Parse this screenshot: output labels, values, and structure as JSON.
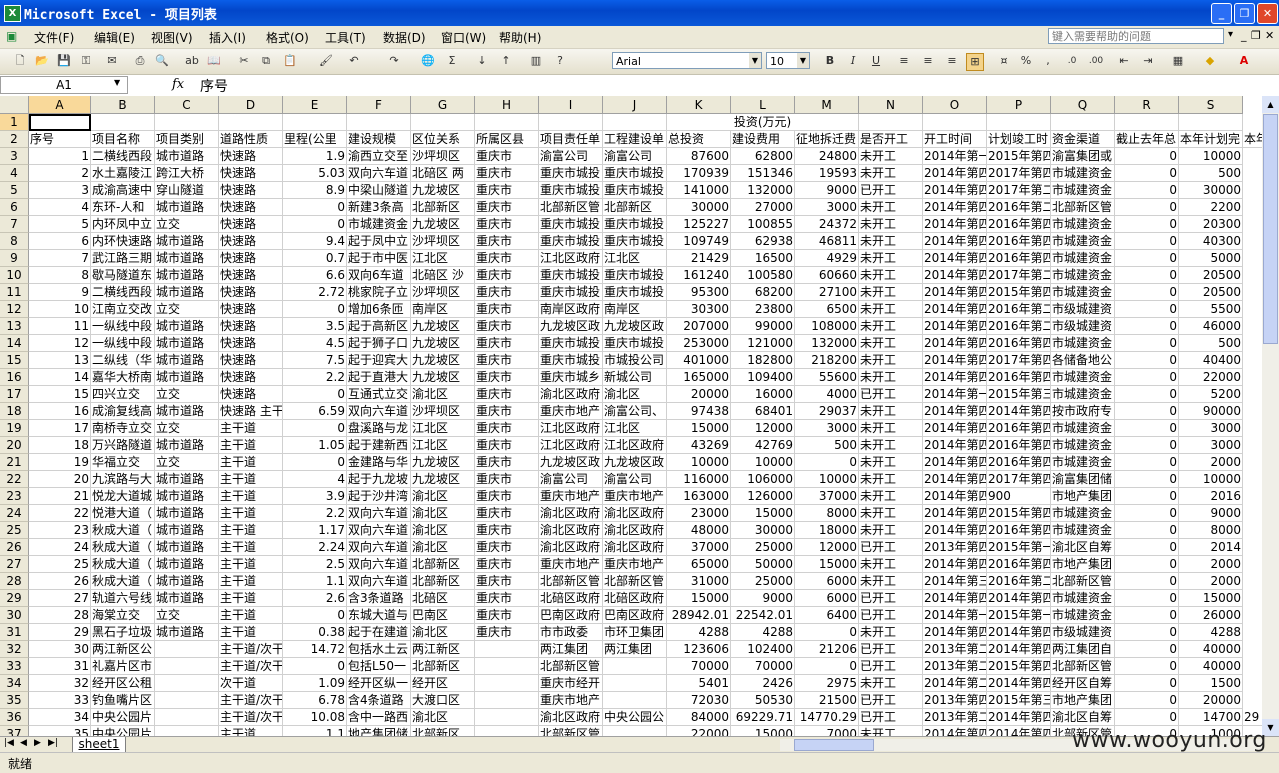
{
  "window": {
    "title": "Microsoft Excel - 项目列表",
    "app_icon": "X"
  },
  "menu": {
    "items": [
      "文件(F)",
      "编辑(E)",
      "视图(V)",
      "插入(I)",
      "格式(O)",
      "工具(T)",
      "数据(D)",
      "窗口(W)",
      "帮助(H)"
    ],
    "help_placeholder": "键入需要帮助的问题"
  },
  "toolbar": {
    "font": "Arial",
    "size": "10",
    "zoom_icons": [
      "bold",
      "italic",
      "underline"
    ]
  },
  "formula": {
    "cell": "A1",
    "fx": "fx",
    "value": "序号"
  },
  "columns": [
    "A",
    "B",
    "C",
    "D",
    "E",
    "F",
    "G",
    "H",
    "I",
    "J",
    "K",
    "L",
    "M",
    "N",
    "O",
    "P",
    "Q",
    "R",
    "S"
  ],
  "rows_numbers": [
    "1",
    "2",
    "3",
    "4",
    "5",
    "6",
    "7",
    "8",
    "9",
    "10",
    "11",
    "12",
    "13",
    "14",
    "15",
    "16",
    "17",
    "18",
    "19",
    "20",
    "21",
    "22",
    "23",
    "24",
    "25",
    "26",
    "27",
    "28",
    "29",
    "30",
    "31",
    "32",
    "33",
    "34",
    "35",
    "36",
    "37"
  ],
  "row1_merged": "投资(万元)",
  "headers": [
    "序号",
    "项目名称",
    "项目类别",
    "道路性质",
    "里程(公里",
    "建设规模",
    "区位关系",
    "所属区县",
    "项目责任单",
    "工程建设单",
    "总投资",
    "建设费用",
    "征地拆迁费",
    "是否开工",
    "开工时间",
    "计划竣工时",
    "资金渠道",
    "截止去年总",
    "本年计划完",
    "本年"
  ],
  "rows": [
    [
      "1",
      "二横线西段",
      "城市道路",
      "快速路",
      "1.9",
      "渝西立交至",
      "沙坪坝区",
      "重庆市",
      "渝富公司",
      "渝富公司",
      "87600",
      "62800",
      "24800",
      "未开工",
      "2014年第一",
      "2015年第四",
      "渝富集团或",
      "0",
      "10000"
    ],
    [
      "2",
      "水土嘉陵江",
      "跨江大桥",
      "快速路",
      "5.03",
      "双向六车道",
      "北碚区 两",
      "重庆市",
      "重庆市城投",
      "重庆市城投",
      "170939",
      "151346",
      "19593",
      "未开工",
      "2014年第四",
      "2017年第四",
      "市城建资金",
      "0",
      "500"
    ],
    [
      "3",
      "成渝高速中",
      "穿山隧道",
      "快速路",
      "8.9",
      "中梁山隧道",
      "九龙坡区",
      "重庆市",
      "重庆市城投",
      "重庆市城投",
      "141000",
      "132000",
      "9000",
      "已开工",
      "2014年第四",
      "2017年第二",
      "市城建资金",
      "0",
      "30000"
    ],
    [
      "4",
      "东环-人和",
      "城市道路",
      "快速路",
      "0",
      "新建3条高",
      "北部新区",
      "重庆市",
      "北部新区管",
      "北部新区",
      "30000",
      "27000",
      "3000",
      "未开工",
      "2014年第四",
      "2016年第二",
      "北部新区管",
      "0",
      "2200"
    ],
    [
      "5",
      "内环凤中立",
      "立交",
      "快速路",
      "0",
      "市城建资金",
      "九龙坡区",
      "重庆市",
      "重庆市城投",
      "重庆市城投",
      "125227",
      "100855",
      "24372",
      "未开工",
      "2014年第四",
      "2016年第四",
      "市城建资金",
      "0",
      "20300"
    ],
    [
      "6",
      "内环快速路",
      "城市道路",
      "快速路",
      "9.4",
      "起于凤中立",
      "沙坪坝区",
      "重庆市",
      "重庆市城投",
      "重庆市城投",
      "109749",
      "62938",
      "46811",
      "未开工",
      "2014年第四",
      "2016年第四",
      "市城建资金",
      "0",
      "40300"
    ],
    [
      "7",
      "武江路三期",
      "城市道路",
      "快速路",
      "0.7",
      "起于市中医",
      "江北区",
      "重庆市",
      "江北区政府",
      "江北区",
      "21429",
      "16500",
      "4929",
      "未开工",
      "2014年第四",
      "2016年第四",
      "市城建资金",
      "0",
      "5000"
    ],
    [
      "8",
      "歇马隧道东",
      "城市道路",
      "快速路",
      "6.6",
      "双向6车道",
      "北碚区 沙",
      "重庆市",
      "重庆市城投",
      "重庆市城投",
      "161240",
      "100580",
      "60660",
      "未开工",
      "2014年第四",
      "2017年第二",
      "市城建资金",
      "0",
      "20500"
    ],
    [
      "9",
      "二横线西段",
      "城市道路",
      "快速路",
      "2.72",
      "桃家院子立",
      "沙坪坝区",
      "重庆市",
      "重庆市城投",
      "重庆市城投",
      "95300",
      "68200",
      "27100",
      "未开工",
      "2014年第四",
      "2015年第四",
      "市城建资金",
      "0",
      "20500"
    ],
    [
      "10",
      "江南立交改",
      "立交",
      "快速路",
      "0",
      "增加6条匝",
      "南岸区",
      "重庆市",
      "南岸区政府",
      "南岸区",
      "30300",
      "23800",
      "6500",
      "未开工",
      "2014年第四",
      "2016年第二",
      "市级城建资",
      "0",
      "5500"
    ],
    [
      "11",
      "一纵线中段",
      "城市道路",
      "快速路",
      "3.5",
      "起于高新区",
      "九龙坡区",
      "重庆市",
      "九龙坡区政",
      "九龙坡区政",
      "207000",
      "99000",
      "108000",
      "未开工",
      "2014年第四",
      "2016年第二",
      "市级城建资",
      "0",
      "46000"
    ],
    [
      "12",
      "一纵线中段",
      "城市道路",
      "快速路",
      "4.5",
      "起于狮子口",
      "九龙坡区",
      "重庆市",
      "重庆市城投",
      "重庆市城投",
      "253000",
      "121000",
      "132000",
      "未开工",
      "2014年第四",
      "2016年第四",
      "市城建资金",
      "0",
      "500"
    ],
    [
      "13",
      "二纵线（华",
      "城市道路",
      "快速路",
      "7.5",
      "起于迎宾大",
      "九龙坡区",
      "重庆市",
      "重庆市城投",
      "市城投公司",
      "401000",
      "182800",
      "218200",
      "未开工",
      "2014年第四",
      "2017年第四",
      "各储备地公",
      "0",
      "40400"
    ],
    [
      "14",
      "嘉华大桥南",
      "城市道路",
      "快速路",
      "2.2",
      "起于直港大",
      "九龙坡区",
      "重庆市",
      "重庆市城乡",
      "新城公司",
      "165000",
      "109400",
      "55600",
      "未开工",
      "2014年第四",
      "2016年第四",
      "市城建资金",
      "0",
      "22000"
    ],
    [
      "15",
      "四兴立交",
      "立交",
      "快速路",
      "0",
      "互通式立交",
      "渝北区",
      "重庆市",
      "渝北区政府",
      "渝北区",
      "20000",
      "16000",
      "4000",
      "已开工",
      "2014年第一",
      "2015年第三",
      "市城建资金",
      "0",
      "5200"
    ],
    [
      "16",
      "成渝复线高",
      "城市道路",
      "快速路 主干",
      "6.59",
      "双向六车道",
      "沙坪坝区",
      "重庆市",
      "重庆市地产",
      "渝富公司、",
      "97438",
      "68401",
      "29037",
      "未开工",
      "2014年第四",
      "2014年第四",
      "按市政府专",
      "0",
      "90000"
    ],
    [
      "17",
      "南桥寺立交",
      "立交",
      "主干道",
      "0",
      "盘溪路与龙",
      "江北区",
      "重庆市",
      "江北区政府",
      "江北区",
      "15000",
      "12000",
      "3000",
      "未开工",
      "2014年第四",
      "2016年第四",
      "市城建资金",
      "0",
      "3000"
    ],
    [
      "18",
      "万兴路隧道",
      "城市道路",
      "主干道",
      "1.05",
      "起于建新西",
      "江北区",
      "重庆市",
      "江北区政府",
      "江北区政府",
      "43269",
      "42769",
      "500",
      "未开工",
      "2014年第四",
      "2016年第四",
      "市城建资金",
      "0",
      "3000"
    ],
    [
      "19",
      "华福立交",
      "立交",
      "主干道",
      "0",
      "金建路与华",
      "九龙坡区",
      "重庆市",
      "九龙坡区政",
      "九龙坡区政",
      "10000",
      "10000",
      "0",
      "未开工",
      "2014年第四",
      "2016年第四",
      "市城建资金",
      "0",
      "2000"
    ],
    [
      "20",
      "九滨路与大",
      "城市道路",
      "主干道",
      "4",
      "起于九龙坡",
      "九龙坡区",
      "重庆市",
      "渝富公司",
      "渝富公司",
      "116000",
      "106000",
      "10000",
      "未开工",
      "2014年第四",
      "2017年第四",
      "渝富集团储",
      "0",
      "10000"
    ],
    [
      "21",
      "悦龙大道城",
      "城市道路",
      "主干道",
      "3.9",
      "起于沙井湾",
      "渝北区",
      "重庆市",
      "重庆市地产",
      "重庆市地产",
      "163000",
      "126000",
      "37000",
      "未开工",
      "2014年第四",
      "900",
      "市地产集团",
      "0",
      "2016"
    ],
    [
      "22",
      "悦港大道（",
      "城市道路",
      "主干道",
      "2.2",
      "双向六车道",
      "渝北区",
      "重庆市",
      "渝北区政府",
      "渝北区政府",
      "23000",
      "15000",
      "8000",
      "未开工",
      "2014年第四",
      "2015年第四",
      "市城建资金",
      "0",
      "9000"
    ],
    [
      "23",
      "秋成大道（",
      "城市道路",
      "主干道",
      "1.17",
      "双向六车道",
      "渝北区",
      "重庆市",
      "渝北区政府",
      "渝北区政府",
      "48000",
      "30000",
      "18000",
      "未开工",
      "2014年第四",
      "2016年第四",
      "市城建资金",
      "0",
      "8000"
    ],
    [
      "24",
      "秋成大道（",
      "城市道路",
      "主干道",
      "2.24",
      "双向六车道",
      "渝北区",
      "重庆市",
      "渝北区政府",
      "渝北区政府",
      "37000",
      "25000",
      "12000",
      "已开工",
      "2013年第四",
      "2015年第一",
      "渝北区自筹",
      "0",
      "2014"
    ],
    [
      "25",
      "秋成大道（",
      "城市道路",
      "主干道",
      "2.5",
      "双向六车道",
      "北部新区",
      "重庆市",
      "重庆市地产",
      "重庆市地产",
      "65000",
      "50000",
      "15000",
      "未开工",
      "2014年第四",
      "2016年第四",
      "市地产集团",
      "0",
      "2000"
    ],
    [
      "26",
      "秋成大道（",
      "城市道路",
      "主干道",
      "1.1",
      "双向六车道",
      "北部新区",
      "重庆市",
      "北部新区管",
      "北部新区管",
      "31000",
      "25000",
      "6000",
      "未开工",
      "2014年第三",
      "2016年第二",
      "北部新区管",
      "0",
      "2000"
    ],
    [
      "27",
      "轨道六号线",
      "城市道路",
      "主干道",
      "2.6",
      "含3条道路",
      "北碚区",
      "重庆市",
      "北碚区政府",
      "北碚区政府",
      "15000",
      "9000",
      "6000",
      "已开工",
      "2014年第四",
      "2014年第四",
      "市城建资金",
      "0",
      "15000"
    ],
    [
      "28",
      "海棠立交",
      "立交",
      "主干道",
      "0",
      "东城大道与",
      "巴南区",
      "重庆市",
      "巴南区政府",
      "巴南区政府",
      "28942.01",
      "22542.01",
      "6400",
      "已开工",
      "2014年第一",
      "2015年第一",
      "市城建资金",
      "0",
      "26000"
    ],
    [
      "29",
      "黑石子垃圾",
      "城市道路",
      "主干道",
      "0.38",
      "起于在建道",
      "渝北区",
      "重庆市",
      "市市政委",
      "市环卫集团",
      "4288",
      "4288",
      "0",
      "未开工",
      "2014年第四",
      "2014年第四",
      "市级城建资",
      "0",
      "4288"
    ],
    [
      "30",
      "两江新区公",
      "",
      "主干道/次干",
      "14.72",
      "包括水土云",
      "两江新区",
      "",
      "两江集团",
      "两江集团",
      "123606",
      "102400",
      "21206",
      "已开工",
      "2013年第二",
      "2014年第四",
      "两江集团自",
      "0",
      "40000"
    ],
    [
      "31",
      "礼嘉片区市",
      "",
      "主干道/次干",
      "0",
      "包括L50一",
      "北部新区",
      "",
      "北部新区管",
      "",
      "70000",
      "70000",
      "0",
      "已开工",
      "2013年第二",
      "2015年第四",
      "北部新区管",
      "0",
      "40000"
    ],
    [
      "32",
      "经开区公租",
      "",
      "次干道",
      "1.09",
      "经开区纵一",
      "经开区",
      "",
      "重庆市经开",
      "",
      "5401",
      "2426",
      "2975",
      "未开工",
      "2014年第二",
      "2014年第四",
      "经开区自筹",
      "0",
      "1500"
    ],
    [
      "33",
      "钓鱼嘴片区",
      "",
      "主干道/次干",
      "6.78",
      "含4条道路",
      "大渡口区",
      "",
      "重庆市地产",
      "",
      "72030",
      "50530",
      "21500",
      "已开工",
      "2013年第四",
      "2015年第三",
      "市地产集团",
      "0",
      "20000"
    ],
    [
      "34",
      "中央公园片",
      "",
      "主干道/次干",
      "10.08",
      "含中一路西",
      "渝北区",
      "",
      "渝北区政府",
      "中央公园公",
      "84000",
      "69229.71",
      "14770.29",
      "已开工",
      "2013年第二",
      "2014年第四",
      "渝北区自筹",
      "0",
      "14700",
      "29"
    ],
    [
      "35",
      "中央公园片",
      "",
      "主干道",
      "1.1",
      "地产集团储",
      "北部新区",
      "",
      "北部新区管",
      "",
      "22000",
      "15000",
      "7000",
      "未开工",
      "2014年第四",
      "2014年第四",
      "北部新区管",
      "0",
      "1000"
    ]
  ],
  "sheet_tab": "sheet1",
  "status": "就绪",
  "watermark": "www.wooyun.org"
}
